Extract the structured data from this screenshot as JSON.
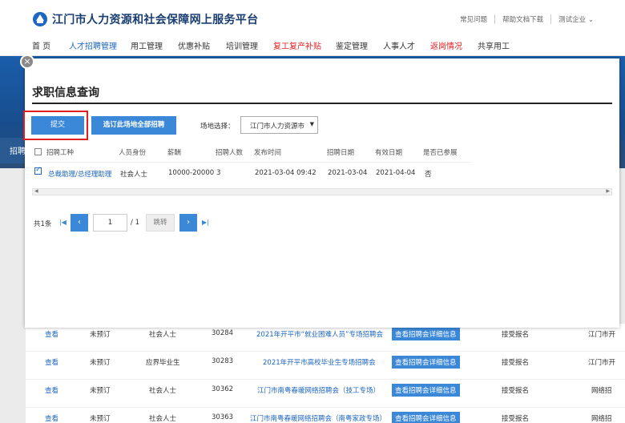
{
  "header": {
    "site_title": "江门市人力资源和社会保障网上服务平台",
    "links": [
      "常见问题",
      "帮助文档下载",
      "测试企业 ⌄"
    ]
  },
  "nav": {
    "items": [
      "首 页",
      "人才招聘管理",
      "用工管理",
      "优惠补贴",
      "培训管理",
      "复工复产补贴",
      "鉴定管理",
      "人事人才",
      "返岗情况",
      "共享用工"
    ],
    "active": "人才招聘管理"
  },
  "side_tab": "招聘",
  "background_rows": [
    {
      "action": "查看",
      "status": "未预订",
      "identity": "社会人士",
      "code": "30284",
      "title": "2021年开平市“就业困难人员”专场招聘会",
      "detail_btn": "查看招聘会详细信息",
      "mode": "接受报名",
      "place": "江门市开"
    },
    {
      "action": "查看",
      "status": "未预订",
      "identity": "应界毕业生",
      "code": "30283",
      "title": "2021年开平市高校毕业生专场招聘会",
      "detail_btn": "查看招聘会详细信息",
      "mode": "接受报名",
      "place": "江门市开"
    },
    {
      "action": "查看",
      "status": "未预订",
      "identity": "社会人士",
      "code": "30362",
      "title": "江门市南粤春暖网络招聘会（技工专场）",
      "detail_btn": "查看招聘会详细信息",
      "mode": "接受报名",
      "place": "网络招"
    },
    {
      "action": "查看",
      "status": "未预订",
      "identity": "社会人士",
      "code": "30363",
      "title": "江门市南粤春暖网络招聘会（南粤家政专场）",
      "detail_btn": "查看招聘会详细信息",
      "mode": "接受报名",
      "place": "网络招"
    }
  ],
  "modal": {
    "close": "×",
    "title": "求职信息查询",
    "submit_label": "提交",
    "select_all_label": "选订此场地全部招聘",
    "venue_label": "场地选择：",
    "venue_value": "江门市人力资源市",
    "columns": [
      "招聘工种",
      "人员身份",
      "薪酬",
      "招聘人数",
      "发布时间",
      "招聘日期",
      "有效日期",
      "是否已参展"
    ],
    "rows": [
      {
        "checked": true,
        "job": "总裁助理/总经理助理",
        "identity": "社会人士",
        "salary": "10000-20000",
        "count": "3",
        "publish_time": "2021-03-04 09:42",
        "recruit_date": "2021-03-04",
        "valid_date": "2021-04-04",
        "attended": "否"
      }
    ],
    "pager": {
      "total": "共1条",
      "first": "|◀",
      "prev": "‹",
      "page": "1",
      "of": "/ 1",
      "jump": "跳转",
      "next": "›",
      "last": "▶|"
    }
  }
}
